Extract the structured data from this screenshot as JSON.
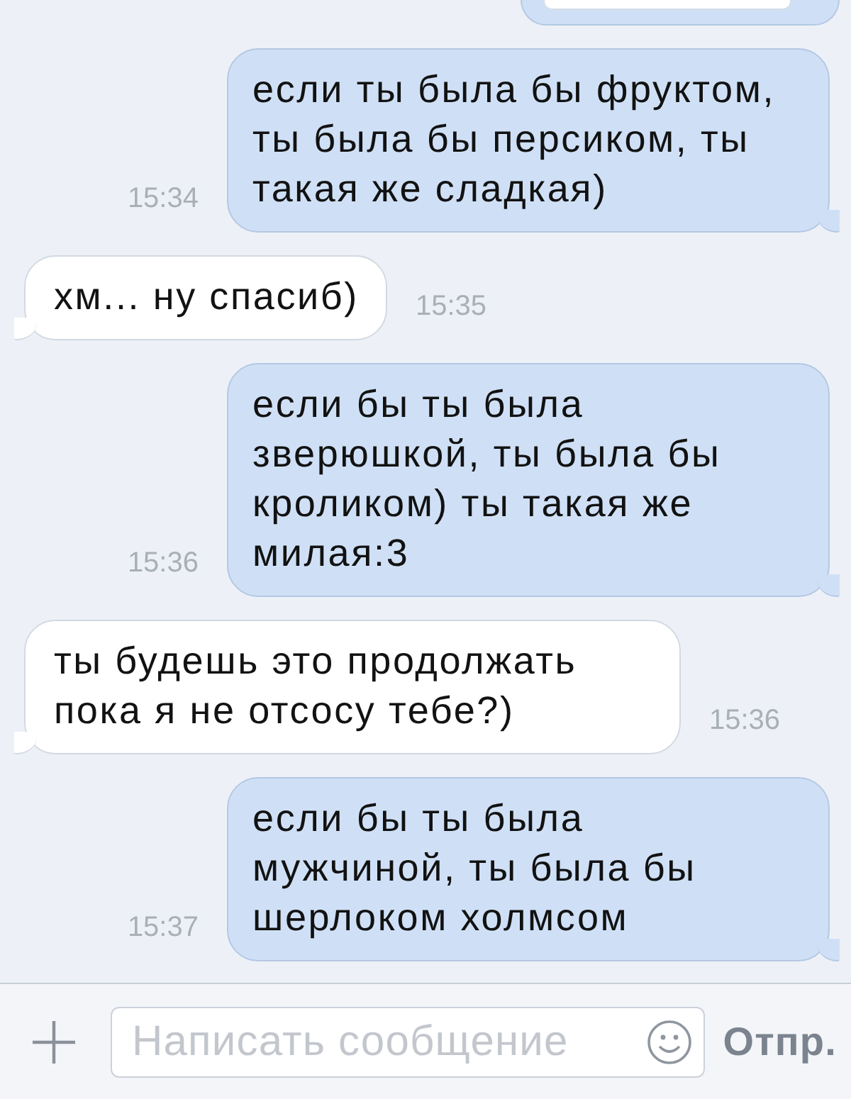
{
  "messages": [
    {
      "kind": "partial",
      "outgoing": true
    },
    {
      "kind": "text",
      "outgoing": true,
      "text": "если ты была бы фруктом, ты была бы персиком, ты такая же сладкая)",
      "time": "15:34"
    },
    {
      "kind": "text",
      "outgoing": false,
      "text": "хм... ну спасиб)",
      "time": "15:35"
    },
    {
      "kind": "text",
      "outgoing": true,
      "text": "если бы ты была зверюшкой, ты была бы кроликом) ты такая же милая:3",
      "time": "15:36"
    },
    {
      "kind": "text",
      "outgoing": false,
      "text": "ты будешь это продолжать пока я не отсосу тебе?)",
      "time": "15:36"
    },
    {
      "kind": "text",
      "outgoing": true,
      "text": "если бы ты была мужчиной, ты была бы шерлоком холмсом",
      "time": "15:37"
    }
  ],
  "composer": {
    "placeholder": "Написать сообщение",
    "send_label": "Отпр."
  }
}
